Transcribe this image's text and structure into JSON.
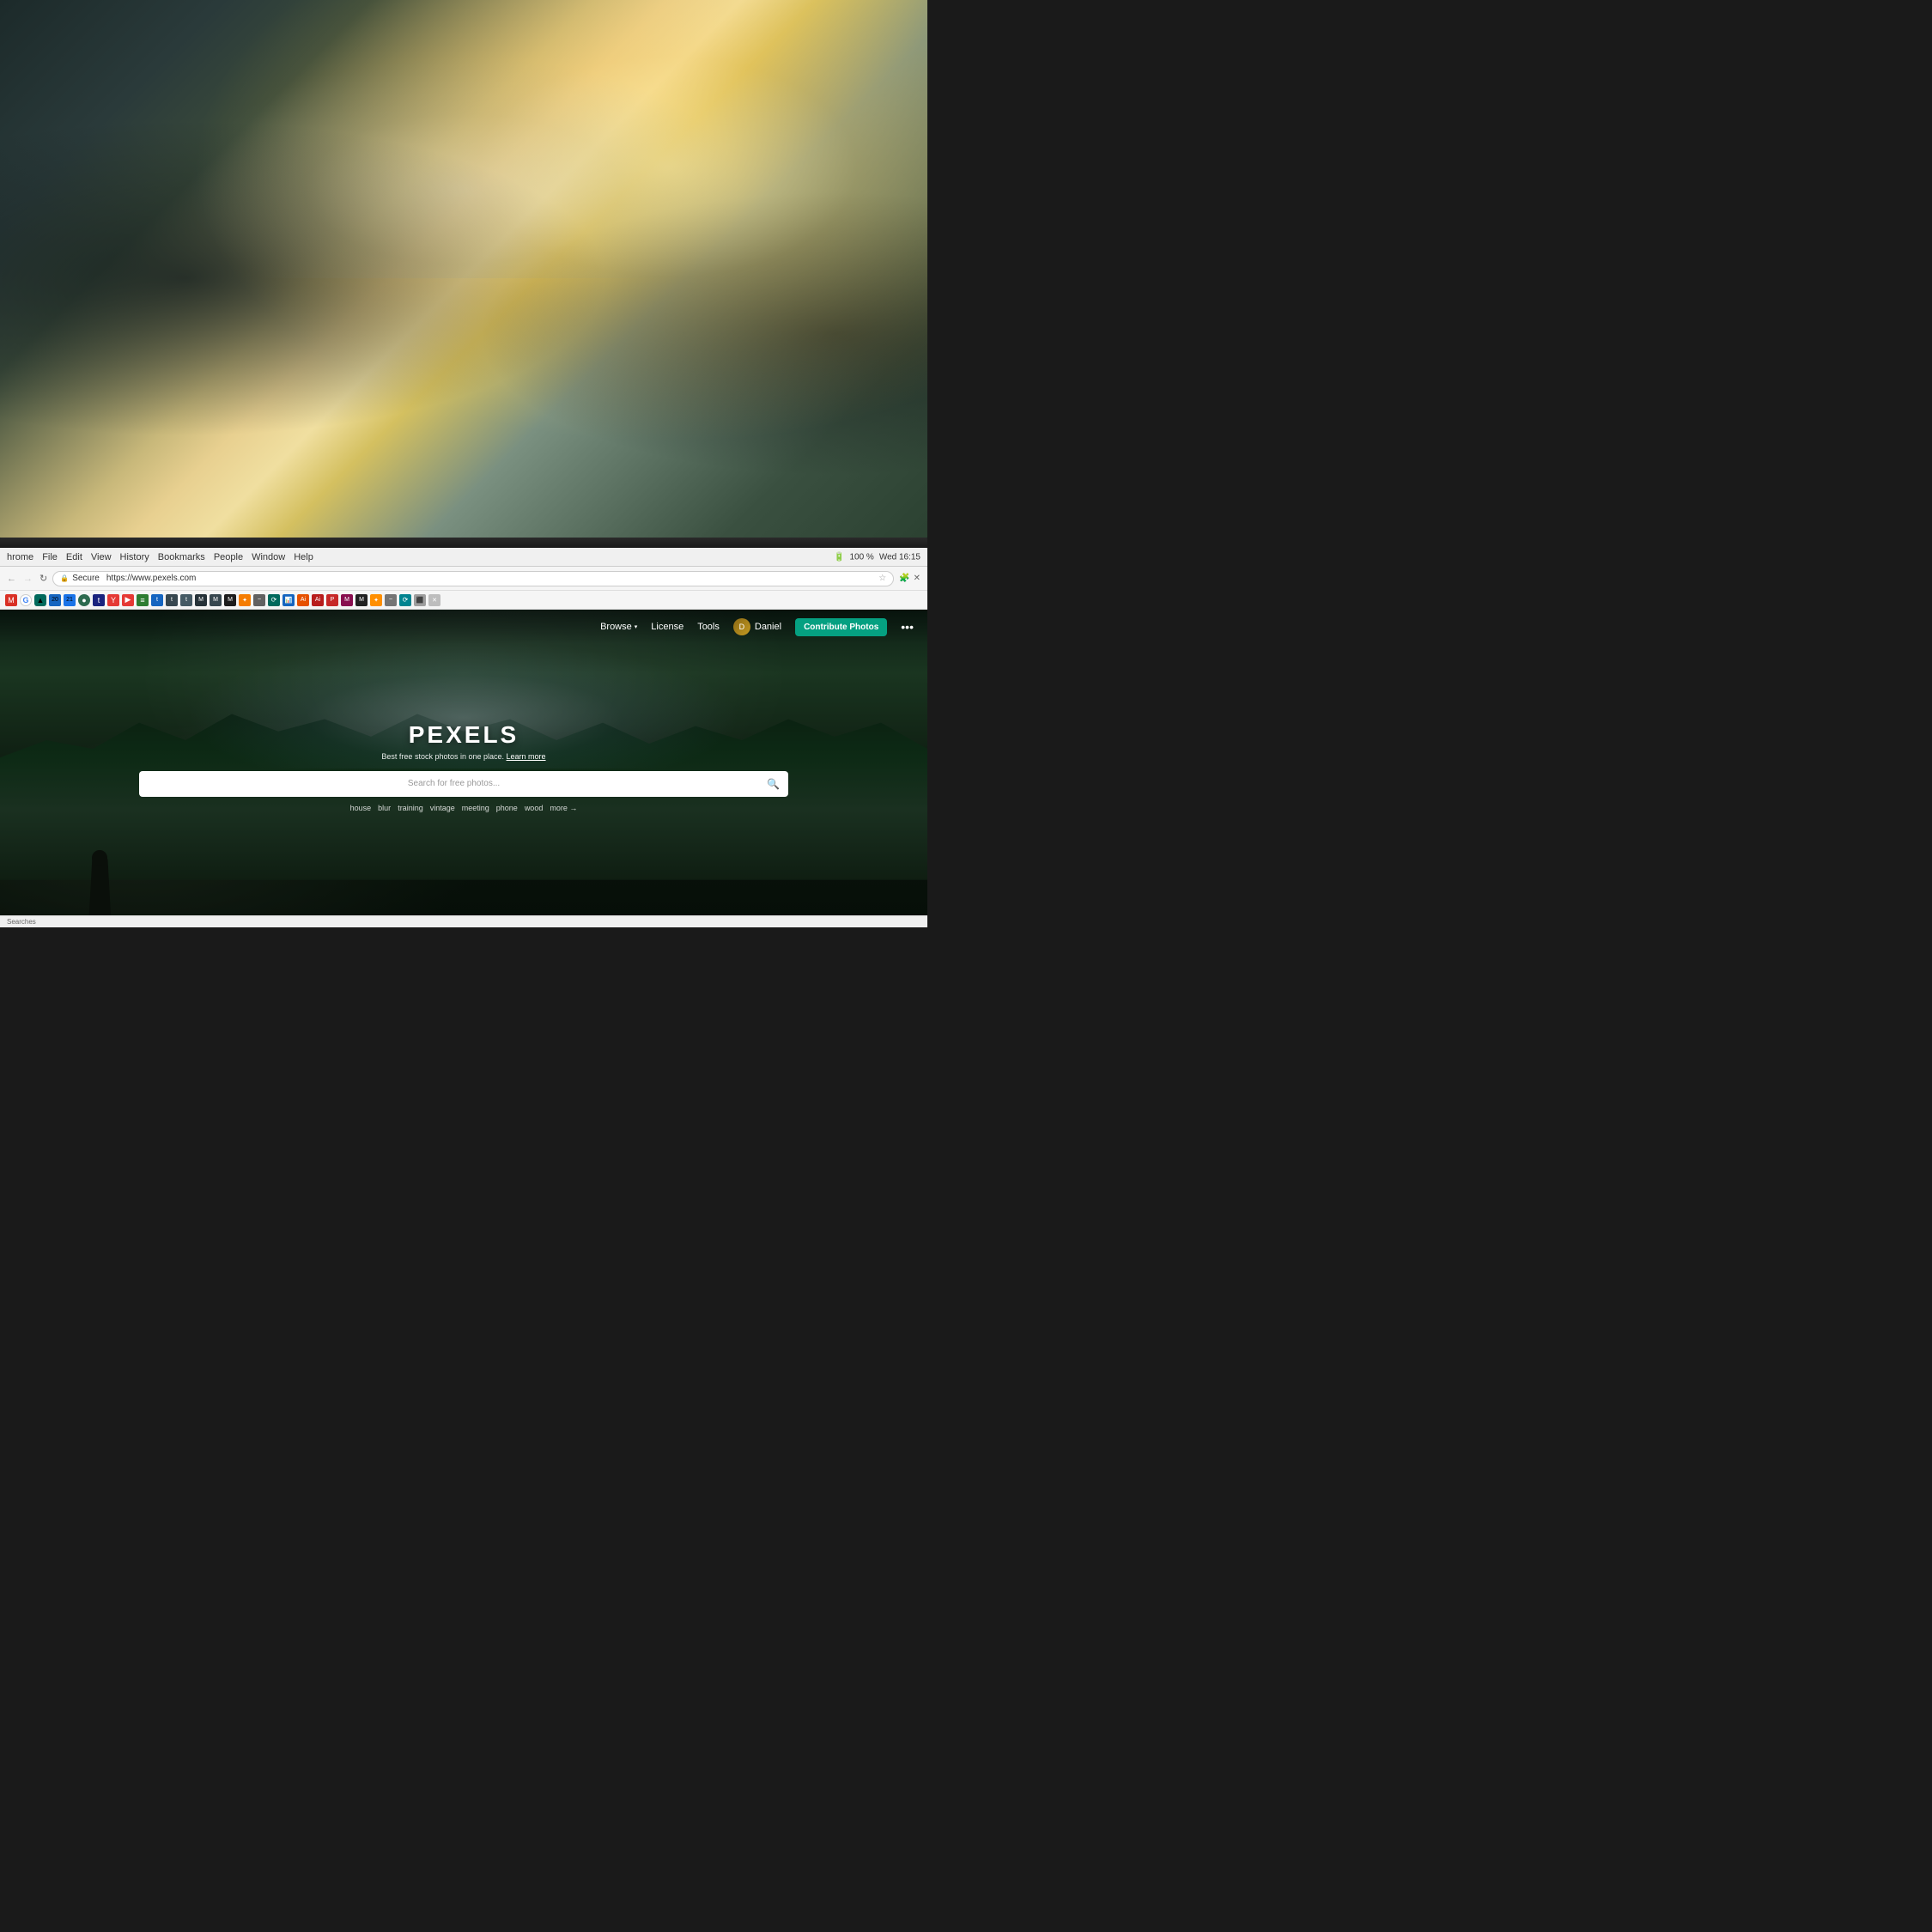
{
  "background": {
    "office_scene": "office with warm backlight through windows, plants, columns"
  },
  "chrome": {
    "menu_items": [
      "hrome",
      "File",
      "Edit",
      "View",
      "History",
      "Bookmarks",
      "People",
      "Window",
      "Help"
    ],
    "time": "Wed 16:15",
    "battery": "100 %",
    "secure_label": "Secure",
    "url": "https://www.pexels.com"
  },
  "extension_icons": [
    {
      "id": "mail",
      "label": "M",
      "color_class": "ext-m"
    },
    {
      "id": "google",
      "label": "G",
      "color_class": "ext-g"
    },
    {
      "id": "drive",
      "label": "▲",
      "color_class": "ext-teal"
    },
    {
      "id": "calendar2",
      "label": "20",
      "color_class": "ext-blue"
    },
    {
      "id": "calendar3",
      "label": "21",
      "color_class": "ext-red"
    },
    {
      "id": "ext1",
      "label": "●",
      "color_class": "ext-orange"
    },
    {
      "id": "ext2",
      "label": "◆",
      "color_class": "ext-dark"
    },
    {
      "id": "ext3",
      "label": "Y",
      "color_class": "ext-red"
    },
    {
      "id": "ext4",
      "label": "▶",
      "color_class": "ext-red"
    },
    {
      "id": "ext5",
      "label": "≡",
      "color_class": "ext-green"
    },
    {
      "id": "ext6",
      "label": "t",
      "color_class": "ext-blue"
    },
    {
      "id": "ext7",
      "label": "t",
      "color_class": "ext-indigo"
    },
    {
      "id": "ext8",
      "label": "t",
      "color_class": "ext-gray"
    },
    {
      "id": "ext9",
      "label": "M",
      "color_class": "ext-navy"
    },
    {
      "id": "ext10",
      "label": "M",
      "color_class": "ext-dark"
    },
    {
      "id": "ext11",
      "label": "M",
      "color_class": "ext-dark"
    },
    {
      "id": "ext12",
      "label": "✦",
      "color_class": "ext-gray"
    },
    {
      "id": "ext13",
      "label": "~",
      "color_class": "ext-gray"
    },
    {
      "id": "ext14",
      "label": "⟳",
      "color_class": "ext-teal"
    },
    {
      "id": "ext15",
      "label": "📊",
      "color_class": "ext-blue"
    },
    {
      "id": "ext16",
      "label": "Ai",
      "color_class": "ext-orange"
    },
    {
      "id": "ext17",
      "label": "Ai",
      "color_class": "ext-red"
    },
    {
      "id": "ext18",
      "label": "P",
      "color_class": "ext-red"
    },
    {
      "id": "ext19",
      "label": "M",
      "color_class": "ext-red"
    },
    {
      "id": "ext20",
      "label": "M",
      "color_class": "ext-dark"
    },
    {
      "id": "ext21",
      "label": "M",
      "color_class": "ext-dark"
    },
    {
      "id": "ext22",
      "label": "✦",
      "color_class": "ext-amber"
    },
    {
      "id": "ext23",
      "label": "~",
      "color_class": "ext-gray"
    },
    {
      "id": "ext24",
      "label": "⟳",
      "color_class": "ext-cyan"
    },
    {
      "id": "ext25",
      "label": "⬛",
      "color_class": "ext-gray"
    },
    {
      "id": "ext26",
      "label": "✕",
      "color_class": "ext-gray"
    }
  ],
  "pexels": {
    "nav": {
      "browse_label": "Browse",
      "license_label": "License",
      "tools_label": "Tools",
      "user_name": "Daniel",
      "contribute_label": "Contribute Photos",
      "more_icon": "•••"
    },
    "hero": {
      "title": "PEXELS",
      "subtitle": "Best free stock photos in one place.",
      "learn_more": "Learn more",
      "search_placeholder": "Search for free photos...",
      "search_tags": [
        "house",
        "blur",
        "training",
        "vintage",
        "meeting",
        "phone",
        "wood"
      ],
      "more_tag": "more →"
    }
  },
  "statusbar": {
    "label": "Searches"
  }
}
